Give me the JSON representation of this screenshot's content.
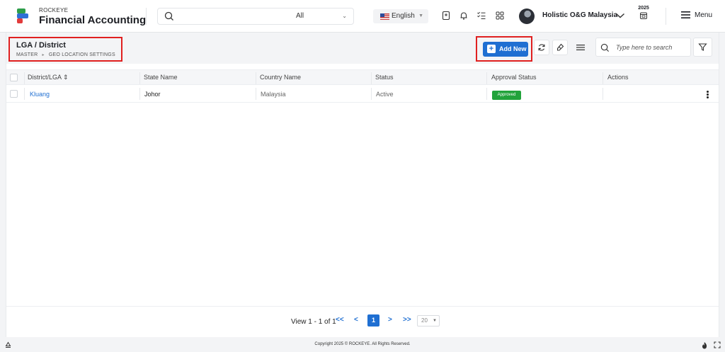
{
  "app": {
    "brand_small": "ROCKEYE",
    "brand_name": "Financial Accounting"
  },
  "header": {
    "search_scope": "All",
    "language": "English",
    "user_name": "Holistic O&G Malaysia",
    "year": "2025",
    "menu_label": "Menu",
    "icons": [
      "search-icon",
      "bookmark-icon",
      "bell-icon",
      "checklist-icon",
      "apps-grid-icon",
      "chevron-down-icon",
      "calendar-icon",
      "hamburger-icon"
    ]
  },
  "page": {
    "title": "LGA / District",
    "breadcrumb": [
      "MASTER",
      "GEO LOCATION SETTINGS"
    ],
    "breadcrumb_sep": "▸"
  },
  "toolbar": {
    "add_label": "Add New",
    "search_placeholder": "Type here to search",
    "icons": [
      "refresh-icon",
      "clear-icon",
      "columns-icon",
      "search-icon",
      "filter-icon"
    ]
  },
  "table": {
    "columns": [
      "District/LGA ⇕",
      "State Name",
      "Country Name",
      "Status",
      "Approval Status",
      "Actions"
    ],
    "rows": [
      {
        "district": "Kluang",
        "state": "Johor",
        "country": "Malaysia",
        "status": "Active",
        "approval": "Approved"
      }
    ]
  },
  "pagination": {
    "info": "View 1 - 1 of 1",
    "first": "<<",
    "prev": "<",
    "current": "1",
    "next": ">",
    "last": ">>",
    "page_size": "20"
  },
  "footer": {
    "copyright": "Copyright 2025 © ROCKEYE. All Rights Reserved."
  },
  "colors": {
    "primary": "#1f6fd2",
    "approved": "#22a33b",
    "highlight": "#e02020"
  }
}
